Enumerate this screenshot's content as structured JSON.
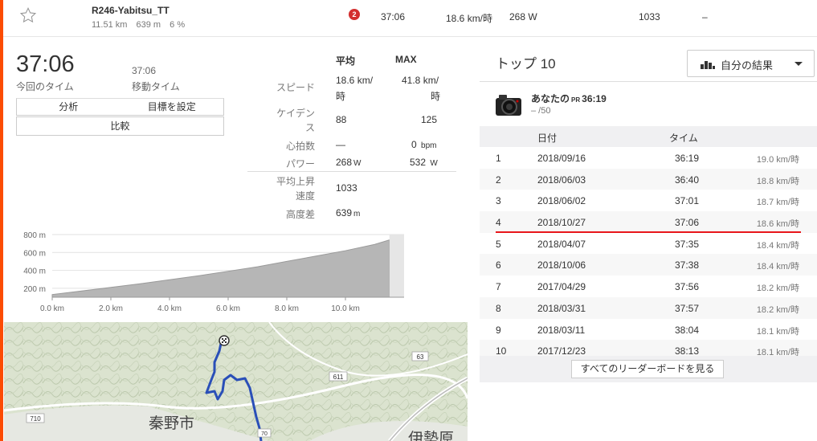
{
  "segment": {
    "name": "R246-Yabitsu_TT",
    "distance": "11.51 km",
    "elevation": "639 m",
    "grade": "6 %",
    "badge": "2",
    "time": "37:06",
    "speed": "18.6 km/時",
    "power": "268 W",
    "vam": "1033",
    "hr": "–"
  },
  "effort": {
    "elapsed_time": "37:06",
    "elapsed_label": "今回のタイム",
    "moving_time": "37:06",
    "moving_label": "移動タイム",
    "buttons": {
      "analyze": "分析",
      "goal": "目標を設定",
      "compare": "比較"
    }
  },
  "stats": {
    "col_avg": "平均",
    "col_max": "MAX",
    "speed": {
      "label": "スピード",
      "avg": "18.6",
      "avg_unit": "km/",
      "avg_unit2": "時",
      "max": "41.8",
      "max_unit": "km/",
      "max_unit2": "時"
    },
    "cadence": {
      "label1": "ケイデン",
      "label2": "ス",
      "avg": "88",
      "max": "125"
    },
    "hr": {
      "label": "心拍数",
      "avg": "—",
      "max": "0",
      "max_unit": "bpm"
    },
    "power": {
      "label": "パワー",
      "avg": "268",
      "avg_unit": "W",
      "max": "532",
      "max_unit": "W"
    },
    "vam": {
      "label1": "平均上昇",
      "label2": "速度",
      "avg": "1033"
    },
    "elev_diff": {
      "label": "高度差",
      "avg": "639",
      "avg_unit": "m"
    }
  },
  "chart_data": {
    "type": "area",
    "x": [
      0.0,
      1.0,
      2.0,
      3.0,
      4.0,
      5.0,
      6.0,
      7.0,
      8.0,
      9.0,
      10.0,
      11.0,
      11.5
    ],
    "values": [
      130,
      170,
      210,
      250,
      295,
      340,
      390,
      440,
      500,
      560,
      620,
      690,
      740
    ],
    "xticks": [
      "0.0 km",
      "2.0 km",
      "4.0 km",
      "6.0 km",
      "8.0 km",
      "10.0 km"
    ],
    "yticks": [
      "800 m",
      "600 m",
      "400 m",
      "200 m"
    ],
    "xlim": [
      0,
      12
    ],
    "ylim": [
      100,
      800
    ],
    "grid": true
  },
  "map": {
    "city": "秦野市",
    "road1": "710",
    "road2": "611",
    "road3": "63",
    "road4": "70",
    "town": "伊勢原"
  },
  "leaderboard": {
    "title": "トップ 10",
    "filter": "自分の結果",
    "me": {
      "label": "あなたの",
      "pr": "PR",
      "time": "36:19",
      "rank": "– /50"
    },
    "cols": {
      "date": "日付",
      "time": "タイム"
    },
    "rows": [
      {
        "rank": "1",
        "date": "2018/09/16",
        "time": "36:19",
        "speed": "19.0 km/時"
      },
      {
        "rank": "2",
        "date": "2018/06/03",
        "time": "36:40",
        "speed": "18.8 km/時"
      },
      {
        "rank": "3",
        "date": "2018/06/02",
        "time": "37:01",
        "speed": "18.7 km/時"
      },
      {
        "rank": "4",
        "date": "2018/10/27",
        "time": "37:06",
        "speed": "18.6 km/時"
      },
      {
        "rank": "5",
        "date": "2018/04/07",
        "time": "37:35",
        "speed": "18.4 km/時"
      },
      {
        "rank": "6",
        "date": "2018/10/06",
        "time": "37:38",
        "speed": "18.4 km/時"
      },
      {
        "rank": "7",
        "date": "2017/04/29",
        "time": "37:56",
        "speed": "18.2 km/時"
      },
      {
        "rank": "8",
        "date": "2018/03/31",
        "time": "37:57",
        "speed": "18.2 km/時"
      },
      {
        "rank": "9",
        "date": "2018/03/11",
        "time": "38:04",
        "speed": "18.1 km/時"
      },
      {
        "rank": "10",
        "date": "2017/12/23",
        "time": "38:13",
        "speed": "18.1 km/時"
      }
    ],
    "highlight_rank": "4",
    "view_all": "すべてのリーダーボードを見る"
  }
}
